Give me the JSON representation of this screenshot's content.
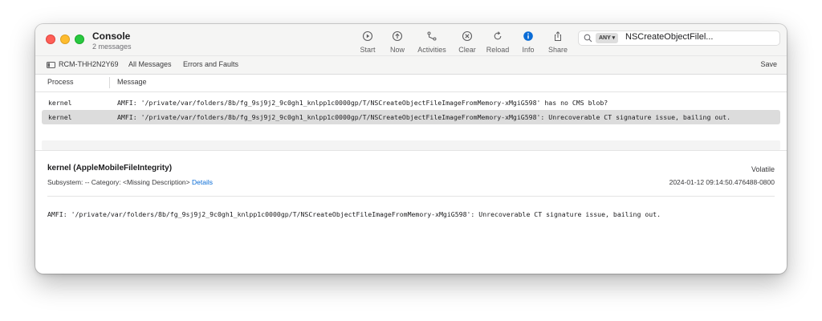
{
  "window": {
    "title": "Console",
    "subtitle": "2 messages"
  },
  "toolbar": {
    "buttons": [
      {
        "label": "Start",
        "icon": "play-circle-icon"
      },
      {
        "label": "Now",
        "icon": "arrow-up-circle-icon"
      },
      {
        "label": "Activities",
        "icon": "activities-icon"
      },
      {
        "label": "Clear",
        "icon": "clear-x-circle-icon"
      },
      {
        "label": "Reload",
        "icon": "reload-icon"
      },
      {
        "label": "Info",
        "icon": "info-icon"
      },
      {
        "label": "Share",
        "icon": "share-icon"
      }
    ],
    "info_color": "#0a6cd6"
  },
  "search": {
    "token": "ANY ▾",
    "text": "NSCreateObjectFilel..."
  },
  "scopebar": {
    "device": "RCM-THH2N2Y69",
    "all_messages": "All Messages",
    "errors_and_faults": "Errors and Faults",
    "save": "Save"
  },
  "columns": {
    "process": "Process",
    "message": "Message"
  },
  "rows": [
    {
      "process": "kernel",
      "message": "AMFI: '/private/var/folders/8b/fg_9sj9j2_9c0gh1_knlpp1c0000gp/T/NSCreateObjectFileImageFromMemory-xMgiG598' has no CMS blob?",
      "selected": false
    },
    {
      "process": "kernel",
      "message": "AMFI: '/private/var/folders/8b/fg_9sj9j2_9c0gh1_knlpp1c0000gp/T/NSCreateObjectFileImageFromMemory-xMgiG598': Unrecoverable CT signature issue, bailing out.",
      "selected": true
    }
  ],
  "detail": {
    "title": "kernel (AppleMobileFileIntegrity)",
    "volatile": "Volatile",
    "meta": "Subsystem: --  Category: <Missing Description>",
    "details_link": "Details",
    "timestamp": "2024-01-12 09:14:50.476488-0800",
    "message": "AMFI: '/private/var/folders/8b/fg_9sj9j2_9c0gh1_knlpp1c0000gp/T/NSCreateObjectFileImageFromMemory-xMgiG598': Unrecoverable CT signature issue, bailing out."
  },
  "colors": {
    "close": "#fe5f57",
    "minimize": "#febc2e",
    "zoom": "#28c840",
    "link": "#0a6cd6",
    "selection": "#dcdcdc"
  }
}
